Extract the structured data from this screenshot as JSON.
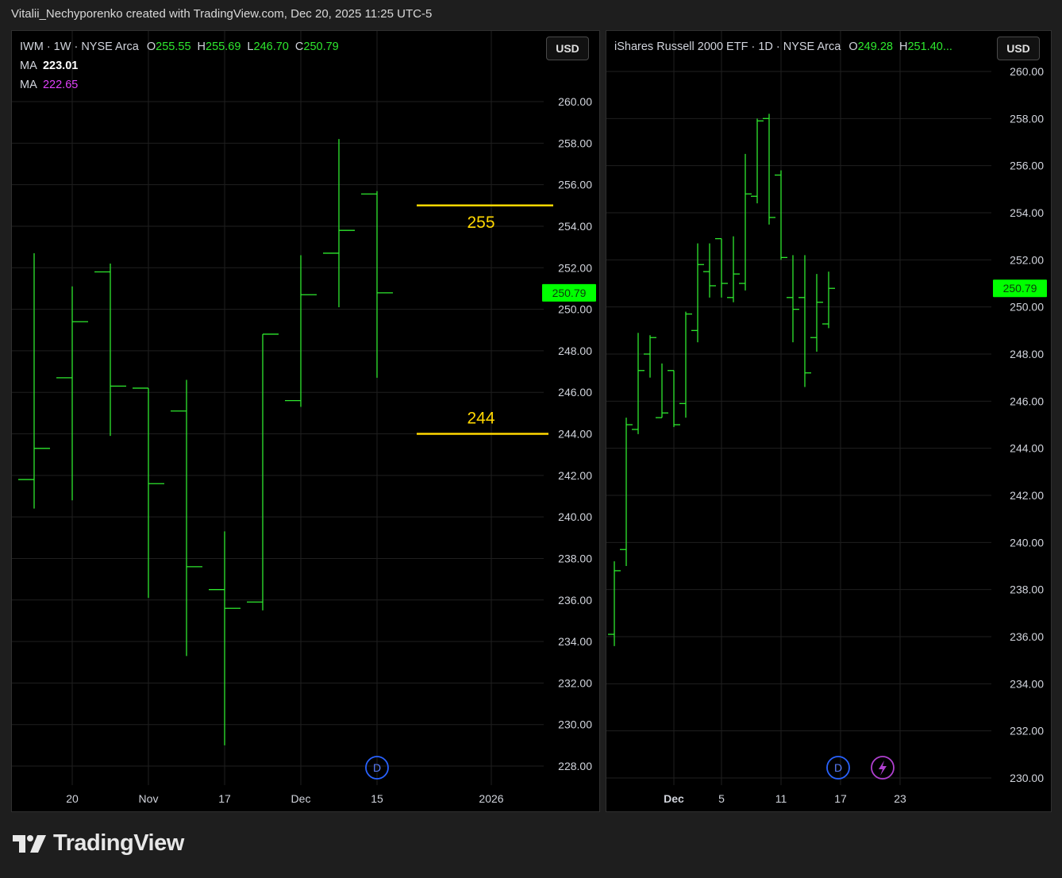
{
  "header": {
    "attribution": "Vitalii_Nechyporenko created with TradingView.com, Dec 20, 2025 11:25 UTC-5"
  },
  "colors": {
    "bar": "#2ee82e",
    "level": "#ffd700",
    "ma1": "#ffffff",
    "ma2": "#e040fb",
    "price_label": "#00ff00",
    "grid": "#1f1f1f",
    "event_d": "#2962ff",
    "event_bolt": "#b040d0"
  },
  "left_panel": {
    "legend": {
      "symbol": "IWM · 1W · NYSE Arca",
      "o_label": "O",
      "o": "255.55",
      "h_label": "H",
      "h": "255.69",
      "l_label": "L",
      "l": "246.70",
      "c_label": "C",
      "c": "250.79"
    },
    "ma_lines": [
      {
        "label": "MA",
        "value": "223.01"
      },
      {
        "label": "MA",
        "value": "222.65"
      }
    ],
    "currency": "USD",
    "event_icon": "D",
    "annotations": [
      {
        "label": "255",
        "price": 255
      },
      {
        "label": "244",
        "price": 244
      }
    ]
  },
  "right_panel": {
    "legend": {
      "symbol": "iShares Russell 2000 ETF · 1D · NYSE Arca",
      "o_label": "O",
      "o": "249.28",
      "h_label": "H",
      "h": "251.40..."
    },
    "currency": "USD",
    "event_icons": [
      "D",
      "bolt"
    ]
  },
  "chart_data": [
    {
      "type": "ohlc",
      "symbol": "IWM",
      "interval": "1W",
      "ylim": [
        226.8,
        261.3
      ],
      "y_ticks": [
        "228.00",
        "230.00",
        "232.00",
        "234.00",
        "236.00",
        "238.00",
        "240.00",
        "242.00",
        "244.00",
        "246.00",
        "248.00",
        "250.00",
        "252.00",
        "254.00",
        "256.00",
        "258.00",
        "260.00"
      ],
      "x_ticks": [
        {
          "label": "20",
          "bar": 1
        },
        {
          "label": "Nov",
          "bar": 3
        },
        {
          "label": "17",
          "bar": 5
        },
        {
          "label": "Dec",
          "bar": 7
        },
        {
          "label": "15",
          "bar": 9
        },
        {
          "label": "2026",
          "bar": 12
        }
      ],
      "last_price": "250.79",
      "bars": [
        {
          "o": 241.8,
          "h": 252.7,
          "l": 240.4,
          "c": 243.3
        },
        {
          "o": 246.7,
          "h": 251.1,
          "l": 240.8,
          "c": 249.4
        },
        {
          "o": 251.8,
          "h": 252.2,
          "l": 243.9,
          "c": 246.3
        },
        {
          "o": 246.2,
          "h": 246.2,
          "l": 236.1,
          "c": 241.6
        },
        {
          "o": 245.1,
          "h": 246.6,
          "l": 233.3,
          "c": 237.6
        },
        {
          "o": 236.5,
          "h": 239.3,
          "l": 229.0,
          "c": 235.6
        },
        {
          "o": 235.9,
          "h": 248.8,
          "l": 235.5,
          "c": 248.8
        },
        {
          "o": 245.6,
          "h": 252.6,
          "l": 245.3,
          "c": 250.7
        },
        {
          "o": 252.7,
          "h": 258.2,
          "l": 250.1,
          "c": 253.8
        },
        {
          "o": 255.55,
          "h": 255.69,
          "l": 246.7,
          "c": 250.79
        }
      ]
    },
    {
      "type": "ohlc",
      "symbol": "IWM",
      "interval": "1D",
      "ylim": [
        230.0,
        261.0
      ],
      "y_ticks": [
        "230.00",
        "232.00",
        "234.00",
        "236.00",
        "238.00",
        "240.00",
        "242.00",
        "244.00",
        "246.00",
        "248.00",
        "250.00",
        "252.00",
        "254.00",
        "256.00",
        "258.00",
        "260.00"
      ],
      "x_ticks": [
        {
          "label": "Dec",
          "bar": 5
        },
        {
          "label": "5",
          "bar": 9
        },
        {
          "label": "11",
          "bar": 14
        },
        {
          "label": "17",
          "bar": 19
        },
        {
          "label": "23",
          "bar": 24
        }
      ],
      "last_price": "250.79",
      "bars": [
        {
          "o": 236.1,
          "h": 239.2,
          "l": 235.6,
          "c": 238.8
        },
        {
          "o": 239.7,
          "h": 245.3,
          "l": 239.0,
          "c": 245.0
        },
        {
          "o": 244.8,
          "h": 248.9,
          "l": 244.6,
          "c": 247.3
        },
        {
          "o": 248.0,
          "h": 248.8,
          "l": 247.0,
          "c": 248.7
        },
        {
          "o": 245.3,
          "h": 247.6,
          "l": 245.3,
          "c": 245.5
        },
        {
          "o": 247.3,
          "h": 247.3,
          "l": 244.9,
          "c": 245.0
        },
        {
          "o": 245.9,
          "h": 249.8,
          "l": 245.3,
          "c": 249.7
        },
        {
          "o": 249.0,
          "h": 252.7,
          "l": 248.5,
          "c": 251.8
        },
        {
          "o": 251.5,
          "h": 252.7,
          "l": 250.4,
          "c": 250.9
        },
        {
          "o": 252.9,
          "h": 252.9,
          "l": 250.4,
          "c": 251.0
        },
        {
          "o": 250.4,
          "h": 253.0,
          "l": 250.2,
          "c": 251.4
        },
        {
          "o": 251.0,
          "h": 256.5,
          "l": 250.7,
          "c": 254.8
        },
        {
          "o": 254.7,
          "h": 258.0,
          "l": 254.4,
          "c": 257.9
        },
        {
          "o": 258.0,
          "h": 258.2,
          "l": 253.5,
          "c": 253.8
        },
        {
          "o": 255.6,
          "h": 255.8,
          "l": 252.0,
          "c": 252.1
        },
        {
          "o": 250.4,
          "h": 252.2,
          "l": 248.5,
          "c": 249.9
        },
        {
          "o": 250.4,
          "h": 252.2,
          "l": 246.6,
          "c": 247.2
        },
        {
          "o": 248.7,
          "h": 251.4,
          "l": 248.1,
          "c": 250.2
        },
        {
          "o": 249.28,
          "h": 251.5,
          "l": 249.1,
          "c": 250.79
        }
      ]
    }
  ]
}
